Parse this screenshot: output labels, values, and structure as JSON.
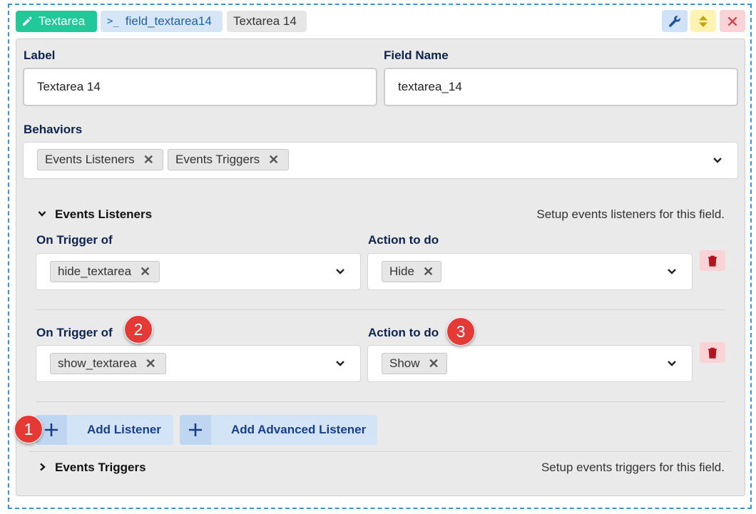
{
  "header": {
    "type_tag": "Textarea",
    "field_tag": "field_textarea14",
    "name_tag": "Textarea 14"
  },
  "form": {
    "label_label": "Label",
    "label_value": "Textarea 14",
    "field_name_label": "Field Name",
    "field_name_value": "textarea_14",
    "behaviors_label": "Behaviors",
    "behaviors": [
      "Events Listeners",
      "Events Triggers"
    ]
  },
  "listeners": {
    "title": "Events Listeners",
    "description": "Setup events listeners for this field.",
    "trigger_label": "On Trigger of",
    "action_label": "Action to do",
    "rows": [
      {
        "trigger": "hide_textarea",
        "action": "Hide"
      },
      {
        "trigger": "show_textarea",
        "action": "Show"
      }
    ],
    "add_listener": "Add Listener",
    "add_advanced_listener": "Add Advanced Listener"
  },
  "triggers": {
    "title": "Events Triggers",
    "description": "Setup events triggers for this field."
  },
  "badges": [
    "1",
    "2",
    "3"
  ],
  "colors": {
    "type_tag": "#20c997",
    "field_tag_bg": "#d6e6f7",
    "danger_bg": "#f9d3d5",
    "badge": "#e53935",
    "dashed_border": "#3b94d9"
  }
}
